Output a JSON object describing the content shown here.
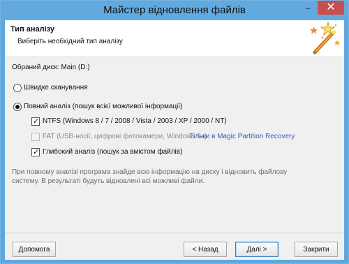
{
  "window": {
    "title": "Майстер відновлення файлів",
    "minimize_label": "–",
    "close_label": "✕"
  },
  "header": {
    "title": "Тип аналізу",
    "subtitle": "Виберіть необхідний тип аналізу",
    "icon": "magic-wand-icon"
  },
  "main": {
    "disk_label": "Обраний диск: Main (D:)",
    "options": {
      "quick_scan_label": "Швидке сканування",
      "full_analysis_label": "Повний аналіз (пошук всієї можливої інформації)",
      "ntfs_label": "NTFS (Windows 8 / 7 / 2008 / Vista / 2003 / XP / 2000 / NT)",
      "fat_label": "FAT (USB-носії, цифрові фотокамери, Windows 9x)",
      "fat_link": "Тільки в Magic Partition Recovery",
      "deep_analysis_label": "Глибокий аналіз (пошук за вмістом файлів)"
    },
    "info_text": "При повному аналізі програма знайде всю інформацію на диску і відновить файлову систему. В результаті будуть відновлені всі можливі файли."
  },
  "footer": {
    "help_label": "Допомога",
    "back_label": "< Назад",
    "next_label": "Далі >",
    "close_label": "Закрити"
  },
  "colors": {
    "titlebar": "#62a9e0",
    "close_button": "#c7504f",
    "link": "#2f62b8"
  }
}
